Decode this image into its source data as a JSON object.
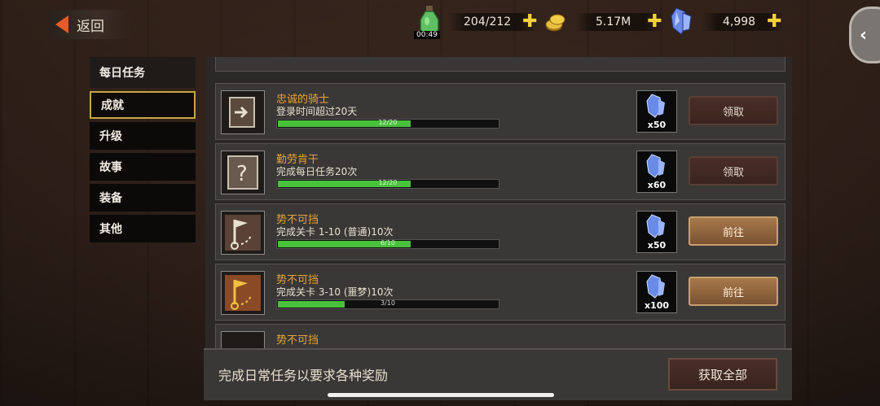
{
  "header": {
    "back_label": "返回",
    "stamina": {
      "value": "204/212",
      "timer": "00:49"
    },
    "gold": {
      "value": "5.17M"
    },
    "crystal": {
      "value": "4,998"
    }
  },
  "menu": {
    "items": [
      {
        "label": "每日任务"
      },
      {
        "label": "成就"
      },
      {
        "label": "升级"
      },
      {
        "label": "故事"
      },
      {
        "label": "装备"
      },
      {
        "label": "其他"
      }
    ],
    "active_index": 1
  },
  "quests": [
    {
      "title": "忠诚的骑士",
      "desc": "登录时间超过20天",
      "progress_text": "12/20",
      "progress": 0.6,
      "reward_qty": "x50",
      "button": "领取",
      "button_type": "claim",
      "icon": "login-door-icon"
    },
    {
      "title": "勤劳肯干",
      "desc": "完成每日任务20次",
      "progress_text": "12/20",
      "progress": 0.6,
      "reward_qty": "x60",
      "button": "领取",
      "button_type": "claim",
      "icon": "question-scroll-icon"
    },
    {
      "title": "势不可挡",
      "desc": "完成关卡 1-10 (普通)10次",
      "progress_text": "6/10",
      "progress": 0.6,
      "reward_qty": "x50",
      "button": "前往",
      "button_type": "go",
      "icon": "flag-map-icon"
    },
    {
      "title": "势不可挡",
      "desc": "完成关卡 3-10 (噩梦)10次",
      "progress_text": "3/10",
      "progress": 0.3,
      "reward_qty": "x100",
      "button": "前往",
      "button_type": "go",
      "icon": "flag-map-gold-icon"
    },
    {
      "title": "势不可挡"
    }
  ],
  "footer": {
    "text": "完成日常任务以要求各种奖励",
    "claim_all": "获取全部"
  },
  "colors": {
    "quest_title": "#e8a23a",
    "progress_fill": "#48c23a",
    "accent_plus": "#f6d23a",
    "back_arrow": "#e85a2a"
  }
}
